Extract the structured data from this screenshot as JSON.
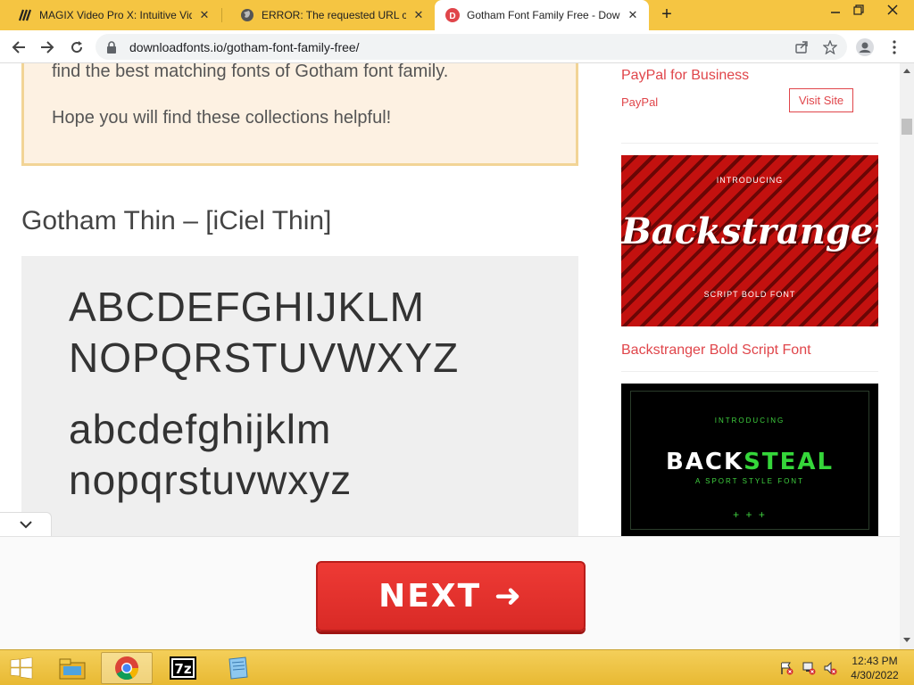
{
  "browser": {
    "tabs": [
      {
        "title": "MAGIX Video Pro X: Intuitive Vid",
        "icon": "magix-icon",
        "active": false
      },
      {
        "title": "ERROR: The requested URL could",
        "icon": "globe-icon",
        "active": false
      },
      {
        "title": "Gotham Font Family Free - Down",
        "icon": "downloadfonts-icon",
        "active": true
      }
    ],
    "new_tab": "+",
    "url": "downloadfonts.io/gotham-font-family-free/"
  },
  "page": {
    "notice_line1": "find the best matching fonts of Gotham font family.",
    "notice_line2": "Hope you will find these collections helpful!",
    "section_title": "Gotham Thin – [iCiel Thin]",
    "sample_lines": [
      "ABCDEFGHIJKLM",
      "NOPQRSTUVWXYZ",
      "abcdefghijklm",
      "nopqrstuvwxyz"
    ]
  },
  "sidebar": {
    "ad_title": "PayPal for Business",
    "ad_sponsor": "PayPal",
    "visit_label": "Visit Site",
    "promo1": {
      "top_text": "INTRODUCING",
      "name": "Backstranger",
      "bottom_text": "SCRIPT BOLD FONT"
    },
    "promo1_link": "Backstranger Bold Script Font",
    "promo2": {
      "top_text": "INTRODUCING",
      "name_white": "BACK",
      "name_green": "STEAL",
      "bottom_text": "A SPORT STYLE FONT",
      "decor": "+ + +"
    }
  },
  "adbar": {
    "next_label": "NEXT ➜"
  },
  "taskbar": {
    "time": "12:43 PM",
    "date": "4/30/2022",
    "apps": [
      "file-explorer-icon",
      "chrome-icon",
      "7zip-icon",
      "notepad-icon"
    ]
  },
  "colors": {
    "tabstrip": "#f5c542",
    "accent_red": "#e0454a",
    "next_button": "#e5322e",
    "notice_bg": "#fdf1e2",
    "notice_border": "#f2d496"
  }
}
